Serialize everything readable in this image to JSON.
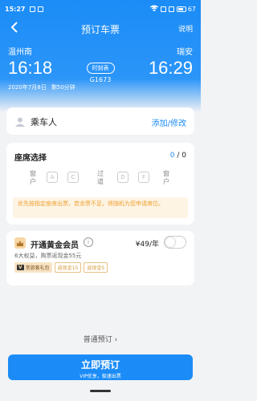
{
  "status_bar": {
    "time": "15:27",
    "battery": "67"
  },
  "nav": {
    "title": "预订车票",
    "help": "说明"
  },
  "train": {
    "departure_station": "温州南",
    "arrival_station": "瑞安",
    "departure_time": "16:18",
    "arrival_time": "16:29",
    "timetable_label": "时刻表",
    "train_no": "G1673",
    "date": "2020年7月8日",
    "remaining": "剩50分钟"
  },
  "passenger": {
    "label": "乘车人",
    "action": "添加/修改"
  },
  "seat": {
    "title": "座席选择",
    "selected": "0",
    "separator": " / ",
    "total": "0",
    "window_left": "窗户",
    "aisle": "过道",
    "window_right": "窗户",
    "seats": [
      "A",
      "C",
      "D",
      "F"
    ],
    "notice": "优先按指定座席出票，若余票不足，将随机为您申请席位。"
  },
  "vip": {
    "title": "开通黄金会员",
    "price": "¥49/年",
    "desc": "6大权益，购票返现金55元",
    "badge_main": "常旅客礼包",
    "badge_v": "V",
    "badge1": "返现金15",
    "badge2": "返现金5",
    "enabled": false
  },
  "footer": {
    "normal_book": "普通预订 ›",
    "book_main": "立即预订",
    "book_sub": "VIP优享，极速出票"
  },
  "colors": {
    "primary": "#1b8cf7",
    "notice_bg": "#fdf4e4",
    "notice_text": "#f0a030"
  }
}
